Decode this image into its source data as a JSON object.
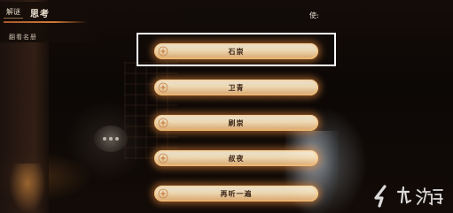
{
  "chapter": {
    "tag": "解谜",
    "title": "思考",
    "subtitle": "翻看名册"
  },
  "banner": {
    "text": "使:"
  },
  "choices": [
    {
      "label": "石崇",
      "selected": true
    },
    {
      "label": "卫青",
      "selected": false
    },
    {
      "label": "刷崇",
      "selected": false
    },
    {
      "label": "叔夜",
      "selected": false
    },
    {
      "label": "再听一遍",
      "selected": false
    }
  ],
  "icons": {
    "choice_icon": "lotus-icon",
    "hint_icon": "speech-bubble-icon",
    "watermark": "jiuyou-logo"
  },
  "watermark": {
    "text": "九游"
  },
  "colors": {
    "choice_glow": "#eb8c3c",
    "choice_fill": "#f8e2ba",
    "accent_underline": "#d07a3a",
    "selection_frame": "#ffffff"
  }
}
